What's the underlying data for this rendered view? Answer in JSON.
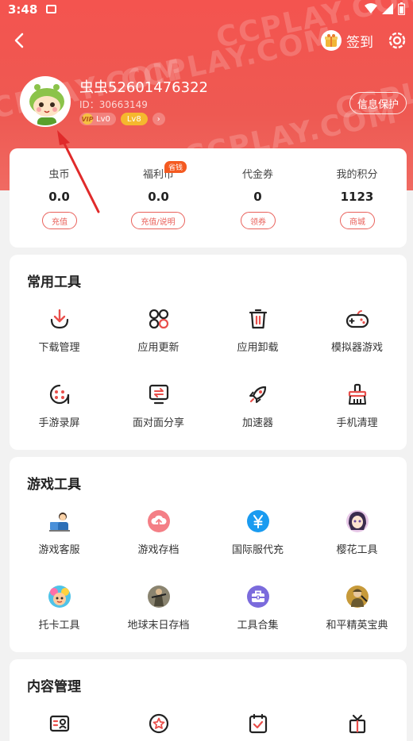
{
  "status": {
    "time": "3:48"
  },
  "watermark": "CCPLAY.COM",
  "header": {
    "signin_label": "签到",
    "info_protect": "信息保护"
  },
  "user": {
    "name": "虫虫52601476322",
    "id": "ID：30663149",
    "vip": "VIP",
    "vip_level": "Lv0",
    "level": "Lv8"
  },
  "currency": [
    {
      "label": "虫币",
      "value": "0.0",
      "button": "充值"
    },
    {
      "label": "福利币",
      "value": "0.0",
      "button": "充值/说明",
      "tag": "省钱"
    },
    {
      "label": "代金券",
      "value": "0",
      "button": "领券"
    },
    {
      "label": "我的积分",
      "value": "1123",
      "button": "商城"
    }
  ],
  "common_tools": {
    "title": "常用工具",
    "items": [
      {
        "label": "下载管理",
        "icon": "download-icon"
      },
      {
        "label": "应用更新",
        "icon": "apps-update-icon"
      },
      {
        "label": "应用卸载",
        "icon": "trash-icon"
      },
      {
        "label": "模拟器游戏",
        "icon": "gamepad-icon"
      },
      {
        "label": "手游录屏",
        "icon": "record-icon"
      },
      {
        "label": "面对面分享",
        "icon": "share-screen-icon"
      },
      {
        "label": "加速器",
        "icon": "rocket-icon"
      },
      {
        "label": "手机清理",
        "icon": "broom-icon"
      }
    ]
  },
  "game_tools": {
    "title": "游戏工具",
    "items": [
      {
        "label": "游戏客服",
        "icon": "support-agent-icon"
      },
      {
        "label": "游戏存档",
        "icon": "cloud-save-icon"
      },
      {
        "label": "国际服代充",
        "icon": "yen-icon"
      },
      {
        "label": "樱花工具",
        "icon": "anime-avatar-icon"
      },
      {
        "label": "托卡工具",
        "icon": "toca-avatar-icon"
      },
      {
        "label": "地球末日存档",
        "icon": "survivor-avatar-icon"
      },
      {
        "label": "工具合集",
        "icon": "toolbox-icon"
      },
      {
        "label": "和平精英宝典",
        "icon": "soldier-avatar-icon"
      }
    ]
  },
  "content_mgmt": {
    "title": "内容管理",
    "items": [
      {
        "icon": "profile-card-icon"
      },
      {
        "icon": "star-badge-icon"
      },
      {
        "icon": "checklist-icon"
      },
      {
        "icon": "gift-box-icon"
      }
    ]
  },
  "colors": {
    "header": "#f4544f",
    "accent": "#e9605a",
    "tag": "#f45a21",
    "level": "#f5b82e"
  }
}
